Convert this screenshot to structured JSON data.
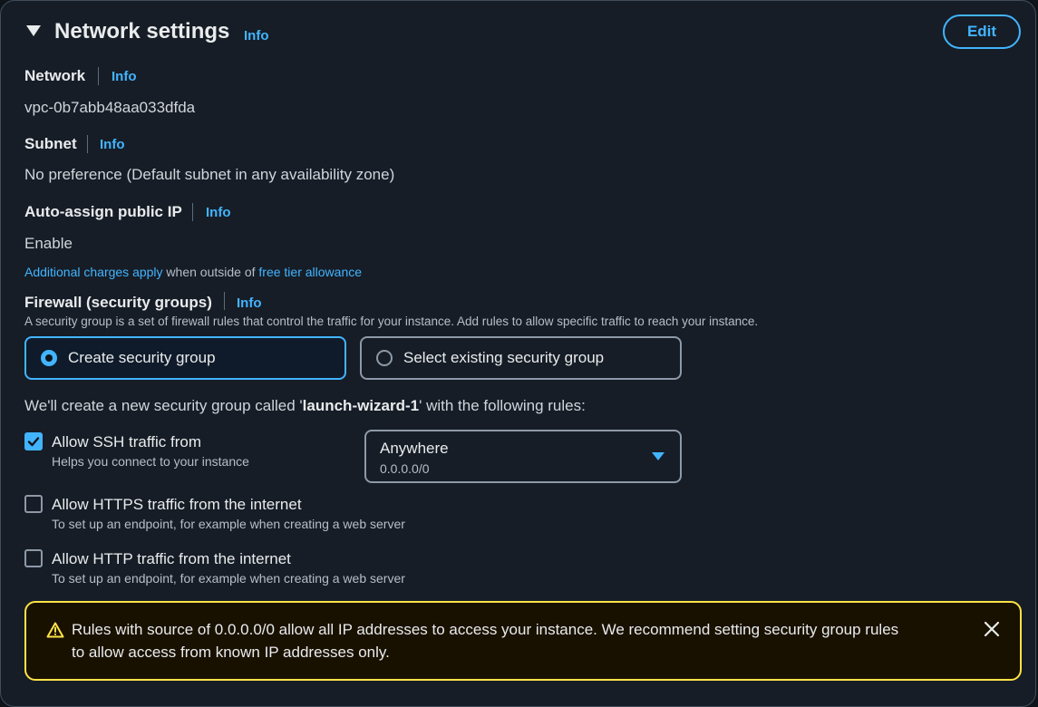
{
  "section": {
    "title": "Network settings",
    "info": "Info",
    "edit_label": "Edit"
  },
  "network": {
    "label": "Network",
    "info": "Info",
    "value": "vpc-0b7abb48aa033dfda"
  },
  "subnet": {
    "label": "Subnet",
    "info": "Info",
    "value": "No preference (Default subnet in any availability zone)"
  },
  "public_ip": {
    "label": "Auto-assign public IP",
    "info": "Info",
    "value": "Enable",
    "charges_link": "Additional charges apply",
    "charges_mid": " when outside of ",
    "free_tier_link": "free tier allowance"
  },
  "firewall": {
    "label": "Firewall (security groups)",
    "info": "Info",
    "description": "A security group is a set of firewall rules that control the traffic for your instance. Add rules to allow specific traffic to reach your instance.",
    "options": [
      {
        "label": "Create security group",
        "selected": true
      },
      {
        "label": "Select existing security group",
        "selected": false
      }
    ],
    "summary_pre": "We'll create a new security group called '",
    "group_name": "launch-wizard-1",
    "summary_post": "' with the following rules:"
  },
  "rules": [
    {
      "label": "Allow SSH traffic from",
      "description": "Helps you connect to your instance",
      "checked": true
    },
    {
      "label": "Allow HTTPS traffic from the internet",
      "description": "To set up an endpoint, for example when creating a web server",
      "checked": false
    },
    {
      "label": "Allow HTTP traffic from the internet",
      "description": "To set up an endpoint, for example when creating a web server",
      "checked": false
    }
  ],
  "ssh_source": {
    "value": "Anywhere",
    "sub": "0.0.0.0/0"
  },
  "alert": {
    "line1": "Rules with source of 0.0.0.0/0 allow all IP addresses to access your instance. We recommend setting security group rules",
    "line2": "to allow access from known IP addresses only."
  },
  "icons": [
    "caret-down-icon",
    "radio-icon",
    "checkbox-icon",
    "dropdown-arrow-icon",
    "warning-icon",
    "close-icon"
  ],
  "colors": {
    "accent": "#42b4ff",
    "warning": "#ffe347",
    "background": "#161d26"
  }
}
